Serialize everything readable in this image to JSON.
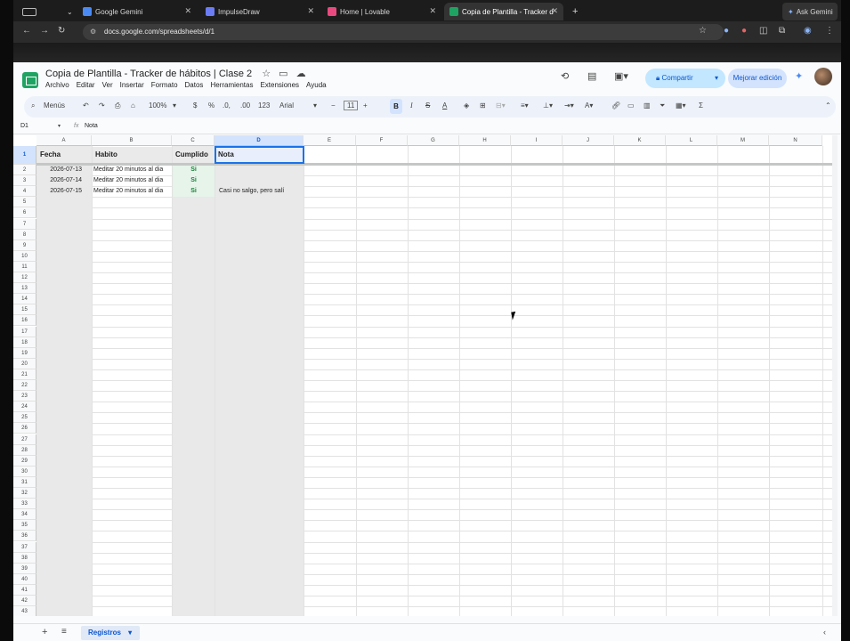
{
  "browser": {
    "tabs": [
      {
        "label": "Google Gemini",
        "icon": "gemini-icon",
        "color": "#4a8af4"
      },
      {
        "label": "ImpulseDraw",
        "icon": "impulsedraw-icon",
        "color": "#6b7cf5"
      },
      {
        "label": "Home | Lovable",
        "icon": "lovable-icon",
        "color": "#e84a7f"
      },
      {
        "label": "Copia de Plantilla - Tracker d",
        "icon": "sheets-icon",
        "color": "#1ea362"
      }
    ],
    "ask_gemini": "Ask Gemini",
    "url": "docs.google.com/spreadsheets/d/1"
  },
  "sheet": {
    "title": "Copia de Plantilla - Tracker de hábitos | Clase 2",
    "menu": [
      "Archivo",
      "Editar",
      "Ver",
      "Insertar",
      "Formato",
      "Datos",
      "Herramientas",
      "Extensiones",
      "Ayuda"
    ],
    "share_label": "Compartir",
    "improve_label": "Mejorar edición",
    "toolbar": {
      "menus": "Menús",
      "zoom": "100%",
      "currency": "$",
      "percent": "%",
      "dec_less": ".0,",
      "dec_more": ".00",
      "number_fmt": "123",
      "font": "Arial",
      "font_size": "11",
      "bold": "B",
      "italic": "I",
      "sigma": "Σ"
    },
    "name_box": "D1",
    "formula_value": "Nota",
    "columns": [
      "A",
      "B",
      "C",
      "D",
      "E",
      "F",
      "G",
      "H",
      "I",
      "J",
      "K",
      "L",
      "M",
      "N"
    ],
    "rows_count": 43,
    "headers": [
      "Fecha",
      "Habito",
      "Cumplido",
      "Nota"
    ],
    "data": [
      [
        "2026-07-13",
        "Meditar 20 minutos al dia",
        "Si",
        ""
      ],
      [
        "2026-07-14",
        "Meditar 20 minutos al dia",
        "Si",
        ""
      ],
      [
        "2026-07-15",
        "Meditar 20 minutos al dia",
        "Si",
        "Casi no salgo, pero salí"
      ]
    ],
    "sheet_tab": "Registros",
    "colors": {
      "green_text": "#188038",
      "green_fill": "#e6f4ea",
      "accent": "#1a73e8"
    }
  }
}
